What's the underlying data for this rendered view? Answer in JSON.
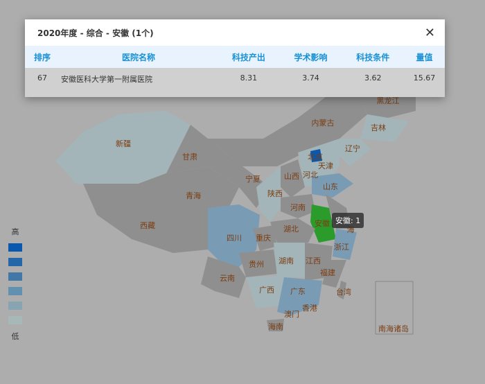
{
  "modal": {
    "title": "2020年度 - 综合 - 安徽 (1个)",
    "close_icon": "close-icon",
    "columns": [
      "排序",
      "医院名称",
      "科技产出",
      "学术影响",
      "科技条件",
      "量值"
    ],
    "rows": [
      [
        "67",
        "安徽医科大学第一附属医院",
        "8.31",
        "3.74",
        "3.62",
        "15.67"
      ]
    ]
  },
  "legend": {
    "high": "高",
    "low": "低",
    "colors": [
      "#0a58ad",
      "#2466a8",
      "#4178a8",
      "#6290b0",
      "#86a4b2",
      "#a6b8b8"
    ]
  },
  "tooltip": "安徽: 1",
  "colors": {
    "highlight": "#2b9b2b",
    "base": "#8f8f8f",
    "light": "#a3b5b8",
    "mid": "#7a9bb4",
    "dark": "#0a58ad"
  },
  "provinces": [
    "黑龙江",
    "吉林",
    "辽宁",
    "内蒙古",
    "北京",
    "天津",
    "河北",
    "山西",
    "山东",
    "新疆",
    "甘肃",
    "宁夏",
    "陕西",
    "青海",
    "河南",
    "安徽",
    "海",
    "西藏",
    "四川",
    "湖北",
    "重庆",
    "浙江",
    "贵州",
    "湖南",
    "江西",
    "福建",
    "云南",
    "广西",
    "广东",
    "台湾",
    "香港",
    "澳门",
    "海南",
    "南海诸岛"
  ]
}
